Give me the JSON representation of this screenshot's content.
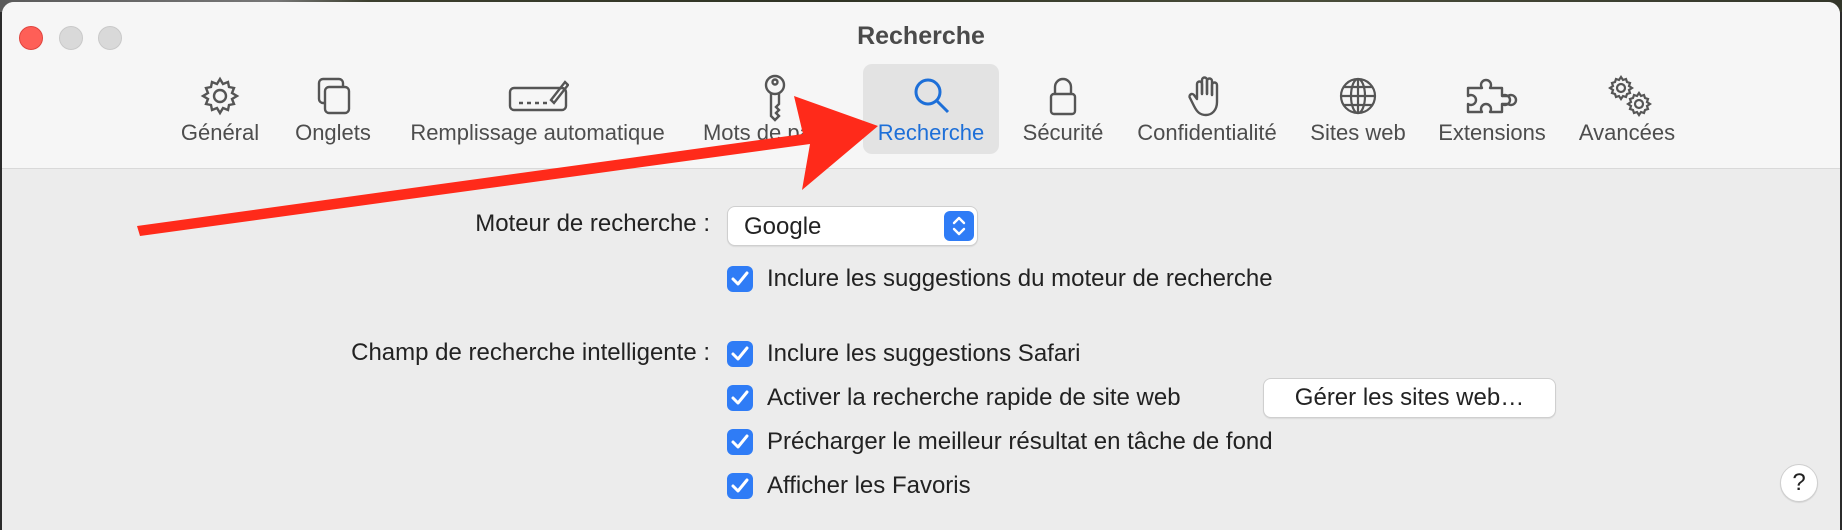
{
  "window": {
    "title": "Recherche"
  },
  "tabs": [
    {
      "label": "Général",
      "icon": "gear-icon"
    },
    {
      "label": "Onglets",
      "icon": "tabs-icon"
    },
    {
      "label": "Remplissage automatique",
      "icon": "autofill-icon"
    },
    {
      "label": "Mots de passe",
      "icon": "key-icon"
    },
    {
      "label": "Recherche",
      "icon": "search-icon",
      "active": true
    },
    {
      "label": "Sécurité",
      "icon": "lock-icon"
    },
    {
      "label": "Confidentialité",
      "icon": "hand-icon"
    },
    {
      "label": "Sites web",
      "icon": "globe-icon"
    },
    {
      "label": "Extensions",
      "icon": "puzzle-icon"
    },
    {
      "label": "Avancées",
      "icon": "advanced-gears-icon"
    }
  ],
  "search_engine": {
    "label": "Moteur de recherche :",
    "value": "Google"
  },
  "engine_suggestions": {
    "label": "Inclure les suggestions du moteur de recherche",
    "checked": true
  },
  "smart_field": {
    "label": "Champ de recherche intelligente :",
    "options": [
      {
        "label": "Inclure les suggestions Safari",
        "checked": true
      },
      {
        "label": "Activer la recherche rapide de site web",
        "checked": true
      },
      {
        "label": "Précharger le meilleur résultat en tâche de fond",
        "checked": true
      },
      {
        "label": "Afficher les Favoris",
        "checked": true
      }
    ],
    "manage_button": "Gérer les sites web…"
  },
  "help": {
    "label": "?"
  },
  "colors": {
    "accent": "#2f7cf6",
    "active_tab_text": "#1d6fd8",
    "annotation_arrow": "#ff2a1a"
  }
}
